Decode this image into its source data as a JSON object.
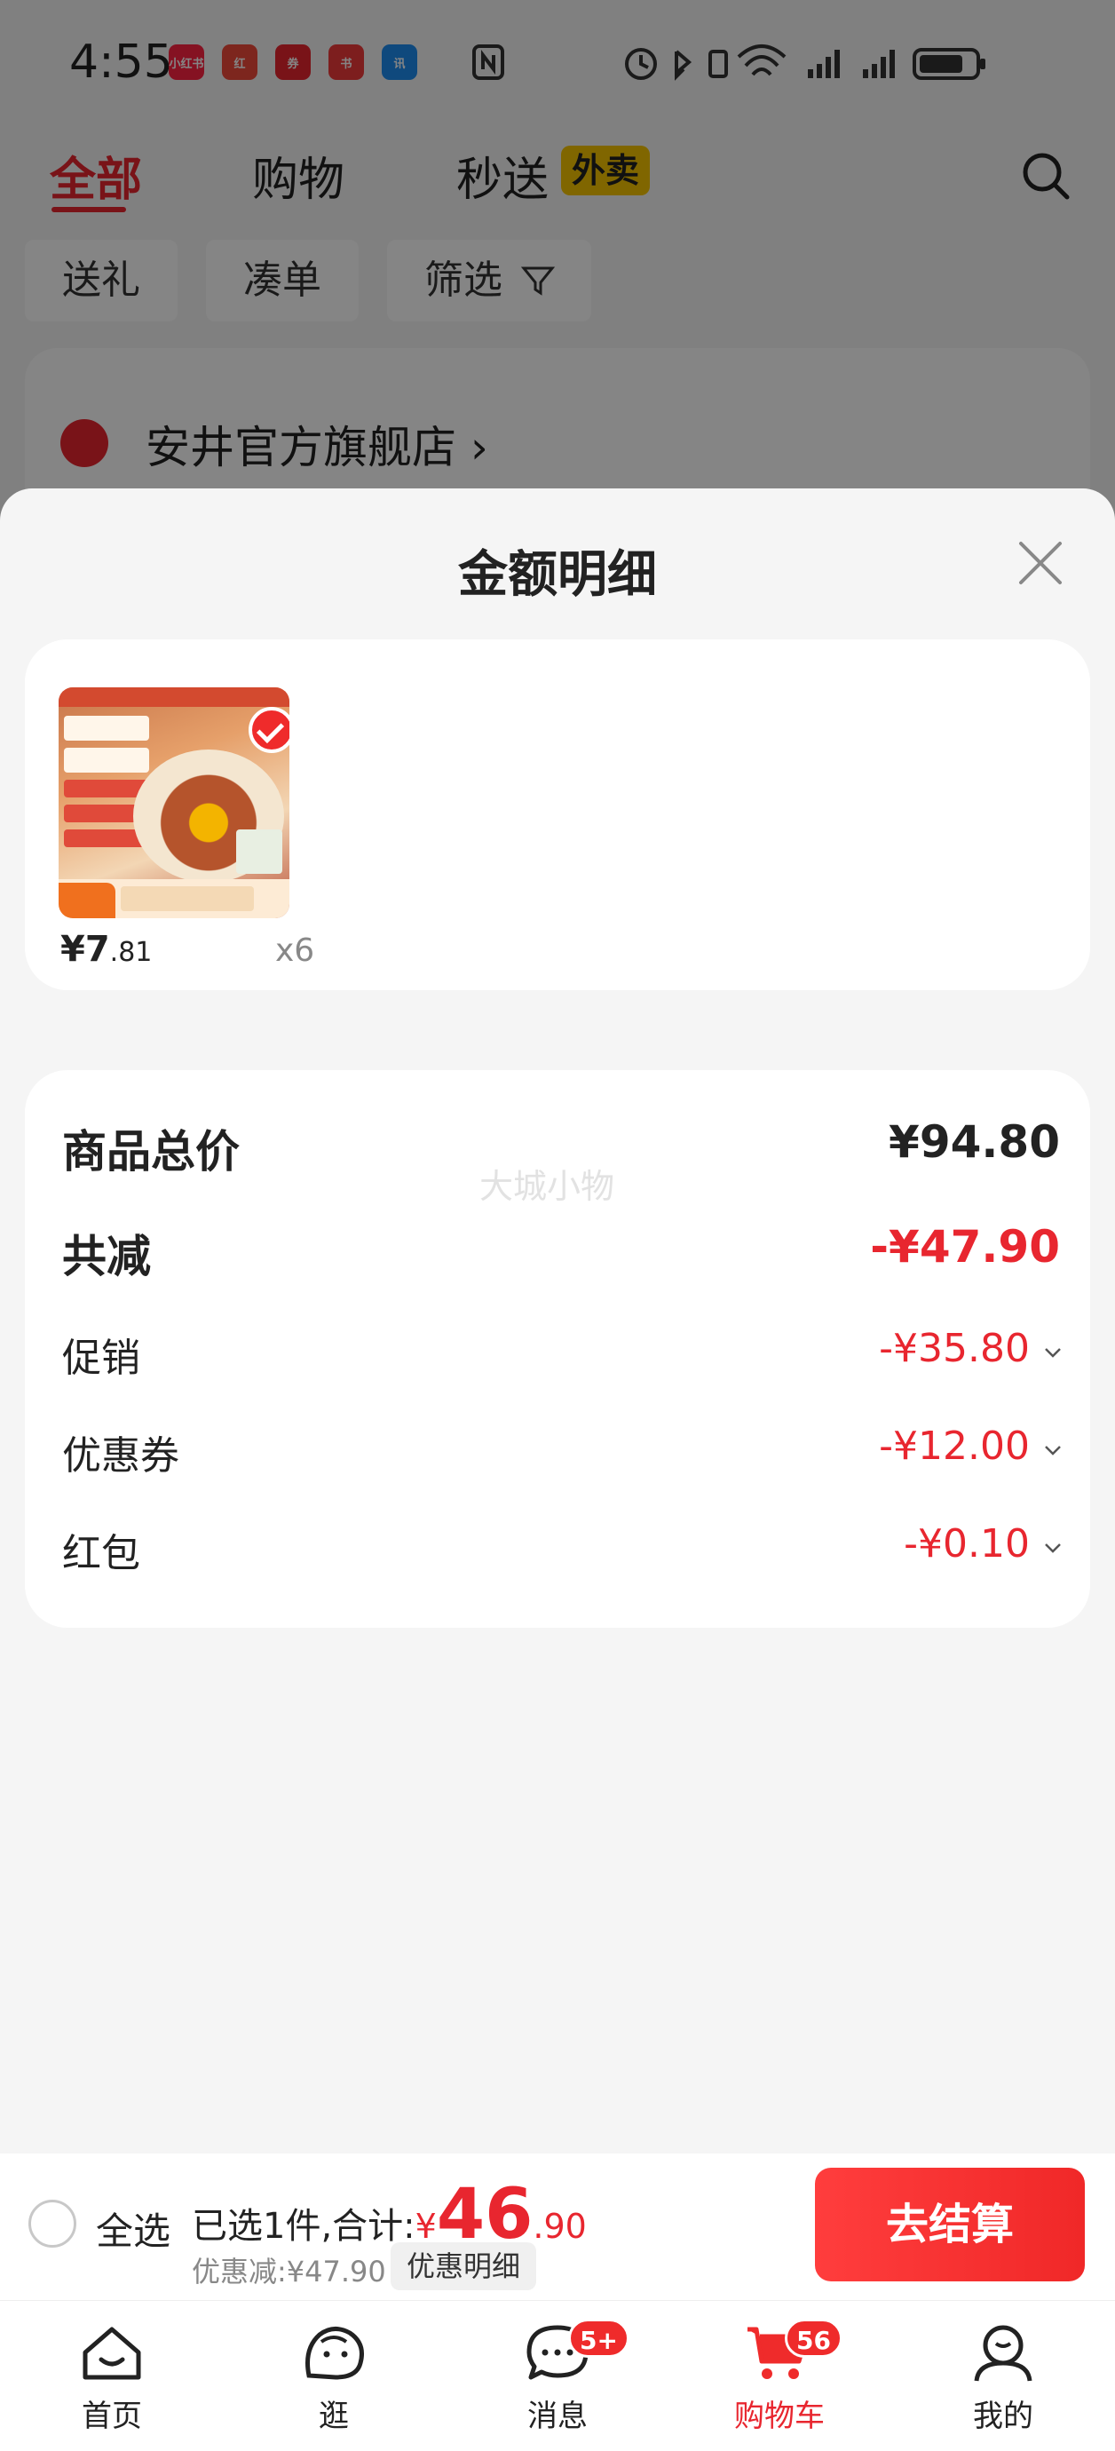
{
  "status_bar": {
    "time": "4:55",
    "app_icons": [
      "小红书",
      "红",
      "券",
      "书",
      "讯"
    ]
  },
  "top_tabs": [
    {
      "label": "全部",
      "active": true
    },
    {
      "label": "购物",
      "active": false
    },
    {
      "label": "秒送",
      "active": false
    }
  ],
  "waimai_badge": "外卖",
  "filter_chips": [
    "送礼",
    "凑单",
    "筛选"
  ],
  "store": {
    "name": "安井官方旗舰店"
  },
  "sheet": {
    "title": "金额明细",
    "item": {
      "price_int": "¥7",
      "price_dec": ".81",
      "quantity": "x6"
    },
    "watermark": "大城小物",
    "rows": {
      "total_label": "商品总价",
      "total_value": "¥94.80",
      "reduce_label": "共减",
      "reduce_value": "-¥47.90",
      "promo_label": "促销",
      "promo_value": "-¥35.80",
      "coupon_label": "优惠券",
      "coupon_value": "-¥12.00",
      "redpack_label": "红包",
      "redpack_value": "-¥0.10"
    }
  },
  "checkout": {
    "select_all": "全选",
    "selected_text": "已选1件,合计:",
    "currency": "¥",
    "amount_int": "46",
    "amount_dec": ".90",
    "discount_text": "优惠减:¥47.90",
    "detail_button": "优惠明细",
    "pay_button": "去结算"
  },
  "bottom_nav": [
    {
      "label": "首页",
      "icon": "home-icon",
      "active": false
    },
    {
      "label": "逛",
      "icon": "browse-icon",
      "active": false
    },
    {
      "label": "消息",
      "icon": "message-icon",
      "active": false,
      "badge": "5+"
    },
    {
      "label": "购物车",
      "icon": "cart-icon",
      "active": true,
      "badge": "56"
    },
    {
      "label": "我的",
      "icon": "profile-icon",
      "active": false
    }
  ],
  "colors": {
    "accent_red": "#e8262f",
    "waimai_yellow": "#f5c400",
    "sheet_bg": "#f5f5f5"
  }
}
